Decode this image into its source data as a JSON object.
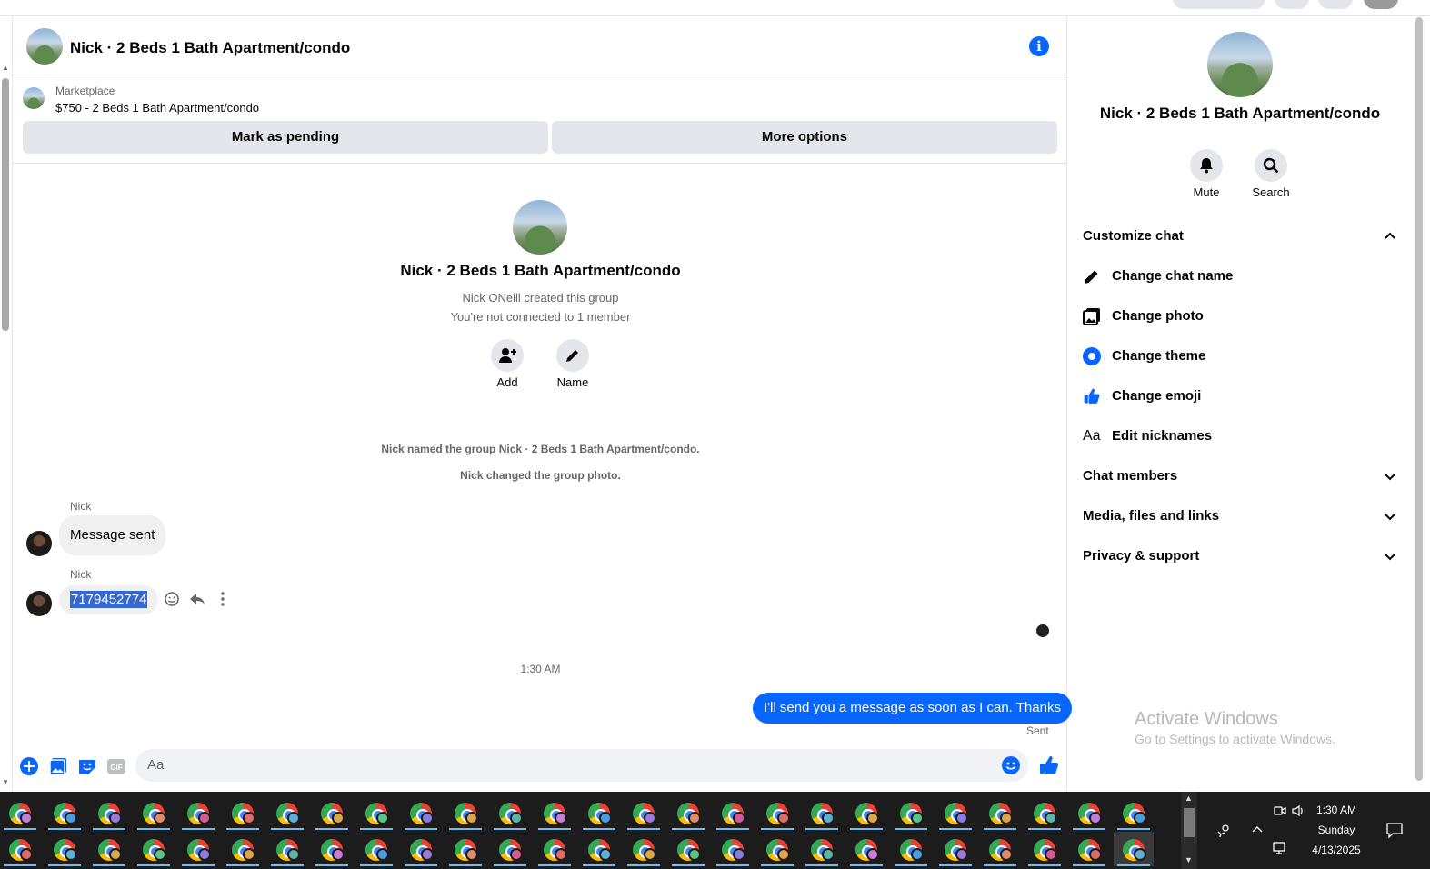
{
  "chat": {
    "title": "Nick · 2 Beds 1 Bath Apartment/condo",
    "marketplace_label": "Marketplace",
    "listing": "$750 - 2 Beds 1 Bath Apartment/condo",
    "mark_pending": "Mark as pending",
    "more_options": "More options"
  },
  "intro": {
    "title": "Nick · 2 Beds 1 Bath Apartment/condo",
    "created_by": "Nick ONeill created this group",
    "not_connected": "You're not connected to 1 member",
    "add_label": "Add",
    "name_label": "Name"
  },
  "system_messages": [
    "Nick named the group Nick · 2 Beds 1 Bath Apartment/condo.",
    "Nick changed the group photo."
  ],
  "messages": [
    {
      "sender": "Nick",
      "text": "Message sent"
    },
    {
      "sender": "Nick",
      "text": "7179452774"
    }
  ],
  "timestamp": "1:30 AM",
  "outgoing": {
    "text": "I'll send you a message as soon as I can. Thanks",
    "status": "Sent"
  },
  "composer": {
    "placeholder": "Aa"
  },
  "panel": {
    "title": "Nick · 2 Beds 1 Bath Apartment/condo",
    "mute_label": "Mute",
    "search_label": "Search",
    "customize_chat": "Customize chat",
    "items": [
      "Change chat name",
      "Change photo",
      "Change theme",
      "Change emoji",
      "Edit nicknames"
    ],
    "chat_members": "Chat members",
    "media_files": "Media, files and links",
    "privacy": "Privacy & support"
  },
  "watermark": {
    "line1": "Activate Windows",
    "line2": "Go to Settings to activate Windows."
  },
  "taskbar": {
    "time": "1:30 AM",
    "day": "Sunday",
    "date": "4/13/2025"
  },
  "colors": {
    "accent": "#0866ff",
    "bubble_incoming": "#f0f0f0",
    "button_bg": "#e4e6eb",
    "taskbar_bg": "#1c1c1c"
  }
}
